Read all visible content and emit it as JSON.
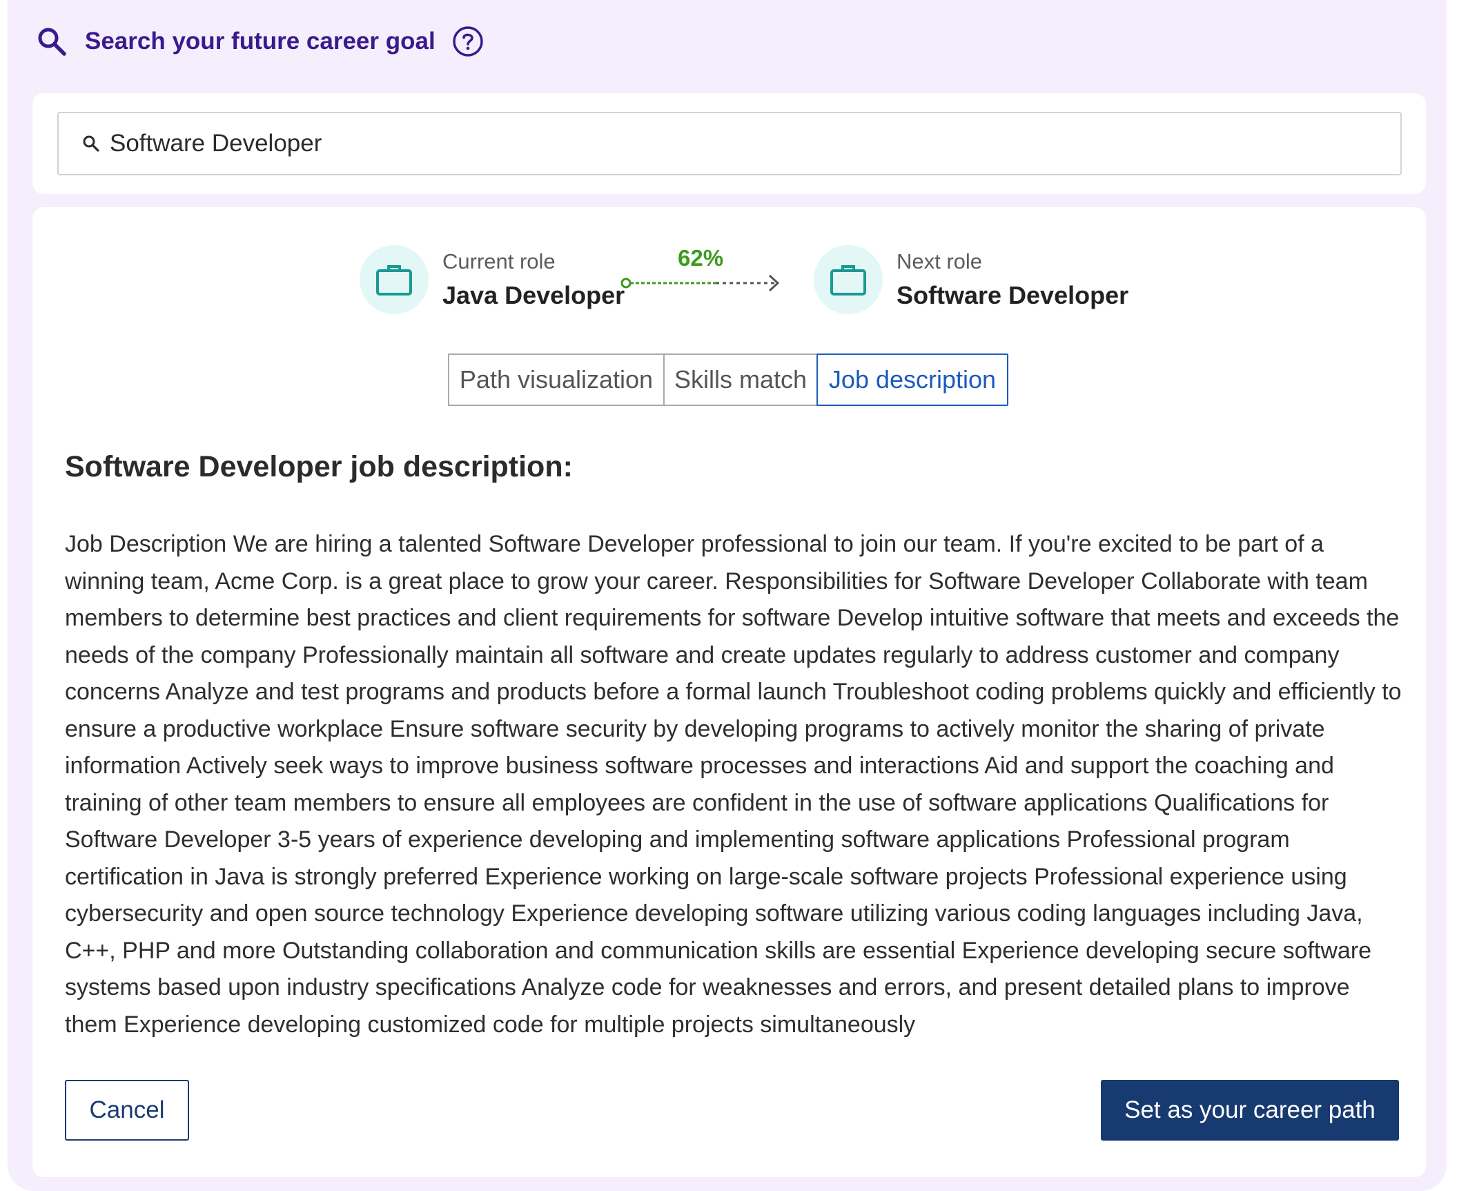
{
  "header": {
    "title": "Search your future career goal",
    "search_icon": "search-icon",
    "help_icon": "help-circle-icon"
  },
  "search": {
    "value": "Software Developer",
    "icon": "search-icon"
  },
  "roles": {
    "current": {
      "label": "Current role",
      "name": "Java Developer",
      "icon": "briefcase-icon"
    },
    "next": {
      "label": "Next role",
      "name": "Software Developer",
      "icon": "briefcase-icon"
    },
    "match_percent": "62%"
  },
  "tabs": [
    {
      "label": "Path visualization",
      "active": false
    },
    {
      "label": "Skills match",
      "active": false
    },
    {
      "label": "Job description",
      "active": true
    }
  ],
  "job_description": {
    "heading": "Software Developer job description:",
    "body": "Job Description We are hiring a talented Software Developer professional to join our team. If you're excited to be part of a winning team, Acme Corp. is a great place to grow your career. Responsibilities for Software Developer Collaborate with team members to determine best practices and client requirements for software Develop intuitive software that meets and exceeds the needs of the company Professionally maintain all software and create updates regularly to address customer and company concerns Analyze and test programs and products before a formal launch Troubleshoot coding problems quickly and efficiently to ensure a productive workplace Ensure software security by developing programs to actively monitor the sharing of private information Actively seek ways to improve business software processes and interactions Aid and support the coaching and training of other team members to ensure all employees are confident in the use of software applications Qualifications for Software Developer 3-5 years of experience developing and implementing software applications Professional program certification in Java is strongly preferred Experience working on large-scale software projects Professional experience using cybersecurity and open source technology Experience developing software utilizing various coding languages including Java, C++, PHP and more Outstanding collaboration and communication skills are essential Experience developing secure software systems based upon industry specifications Analyze code for weaknesses and errors, and present detailed plans to improve them Experience developing customized code for multiple projects simultaneously"
  },
  "actions": {
    "cancel_label": "Cancel",
    "set_label": "Set as your career path"
  },
  "colors": {
    "panel_bg": "#f5eefc",
    "title": "#3a1a8c",
    "accent_teal": "#1a9a93",
    "match_green": "#3e9a1f",
    "active_tab": "#1a5bbf",
    "primary_button": "#173a70"
  }
}
